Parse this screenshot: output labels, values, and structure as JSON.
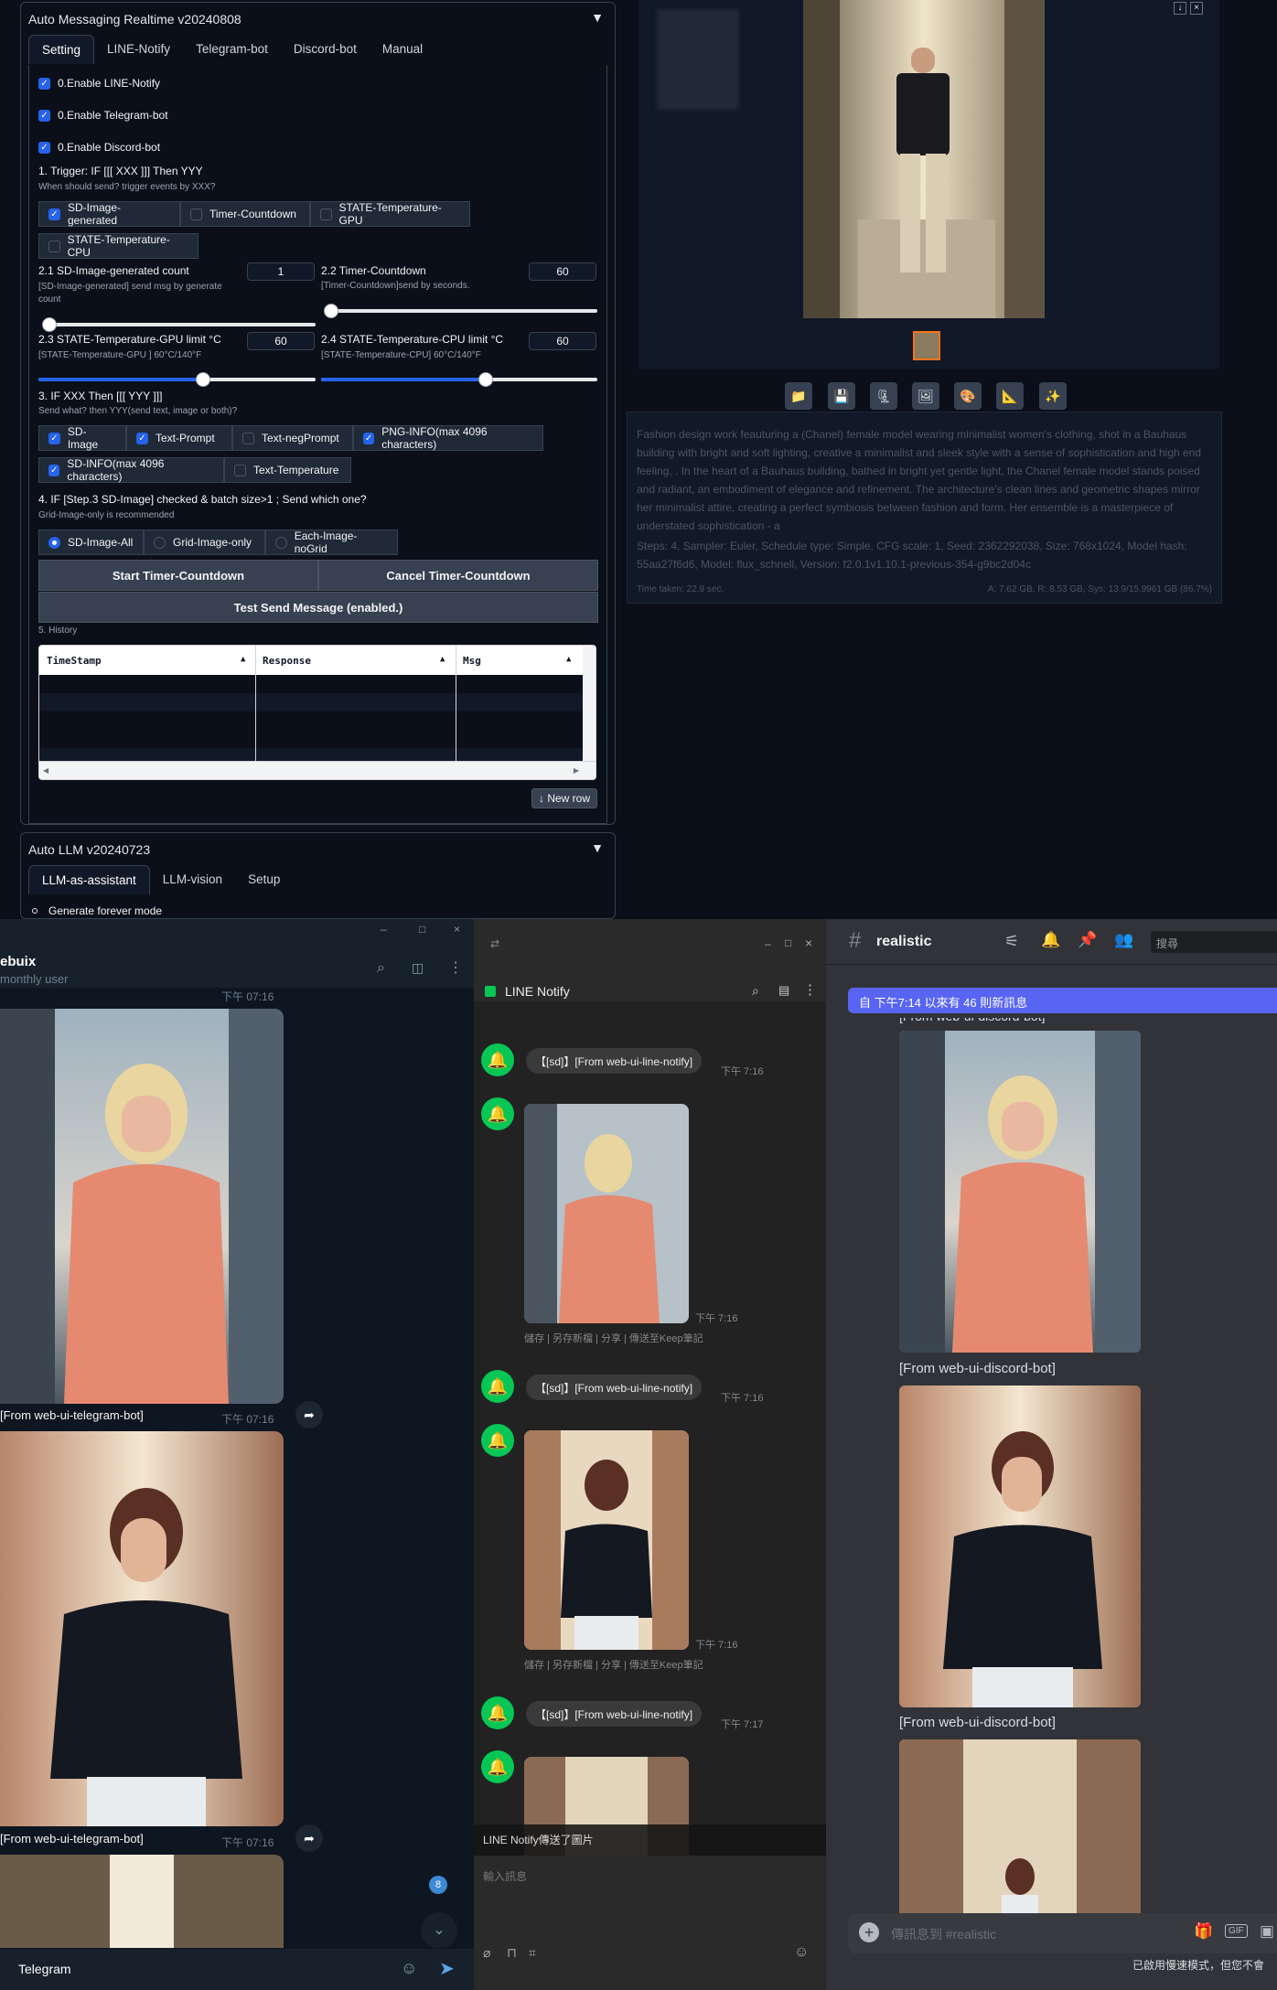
{
  "sd_ui": {
    "messaging": {
      "title": "Auto Messaging Realtime v20240808",
      "tabs": [
        "Setting",
        "LINE-Notify",
        "Telegram-bot",
        "Discord-bot",
        "Manual"
      ],
      "enable_line": "0.Enable LINE-Notify",
      "enable_telegram": "0.Enable Telegram-bot",
      "enable_discord": "0.Enable Discord-bot",
      "trigger_title": "1. Trigger: IF [[[ XXX ]]] Then YYY",
      "trigger_sub": "When should send? trigger events by XXX?",
      "trigger_opts": [
        "SD-Image-generated",
        "Timer-Countdown",
        "STATE-Temperature-GPU",
        "STATE-Temperature-CPU"
      ],
      "count_label": "2.1 SD-Image-generated count",
      "count_sub": "[SD-Image-generated] send msg by generate count",
      "count_value": "1",
      "timer_label": "2.2 Timer-Countdown",
      "timer_sub": "[Timer-Countdown]send by seconds.",
      "timer_value": "60",
      "gpu_label": "2.3 STATE-Temperature-GPU limit °C",
      "gpu_sub": "[STATE-Temperature-GPU ] 60°C/140°F",
      "gpu_value": "60",
      "cpu_label": "2.4 STATE-Temperature-CPU limit °C",
      "cpu_sub": "[STATE-Temperature-CPU] 60°C/140°F",
      "cpu_value": "60",
      "send_title": "3. IF XXX Then [[[ YYY ]]]",
      "send_sub": "Send what? then YYY(send text, image or both)?",
      "send_opts": [
        "SD-Image",
        "Text-Prompt",
        "Text-negPrompt",
        "PNG-INFO(max 4096 characters)",
        "SD-INFO(max 4096 characters)",
        "Text-Temperature"
      ],
      "batch_title": "4. IF [Step.3 SD-Image] checked & batch size>1 ; Send which one?",
      "batch_sub": "Grid-Image-only is recommended",
      "batch_opts": [
        "SD-Image-All",
        "Grid-Image-only",
        "Each-Image-noGrid"
      ],
      "start_btn": "Start Timer-Countdown",
      "cancel_btn": "Cancel Timer-Countdown",
      "test_btn": "Test Send Message (enabled.)",
      "history_title": "5. History",
      "history_cols": [
        "TimeStamp",
        "Response",
        "Msg"
      ],
      "new_row": "↓ New row"
    },
    "llm": {
      "title": "Auto LLM v20240723",
      "tabs": [
        "LLM-as-assistant",
        "LLM-vision",
        "Setup"
      ],
      "forever": "Generate forever mode"
    },
    "info": {
      "prompt": "Fashion design work feauturing a (Chanel) female model wearing minimalist women's clothing, shot in a Bauhaus building with bright and soft lighting, creative a minimalist and sleek style with a sense of sophistication and high end feeling, . In the heart of a Bauhaus building, bathed in bright yet gentle light, the Chanel female model stands poised and radiant, an embodiment of elegance and refinement. The architecture's clean lines and geometric shapes mirror her minimalist attire, creating a perfect symbiosis between fashion and form. Her ensemble is a masterpiece of understated sophistication - a",
      "params": "Steps: 4, Sampler: Euler, Schedule type: Simple, CFG scale: 1, Seed: 2362292038, Size: 768x1024, Model hash: 55aa27f6d6, Model: flux_schnell, Version: f2.0.1v1.10.1-previous-354-g9bc2d04c",
      "time": "Time taken: 22.9 sec.",
      "mem": "A: 7.62 GB, R: 8.53 GB, Sys: 13.9/15.9961 GB (86.7%)"
    }
  },
  "telegram": {
    "title": "ebuix",
    "subtitle": "monthly user",
    "caption": "[From web-ui-telegram-bot]",
    "time": "下午 07:16",
    "unread": "8",
    "input_placeholder": "Telegram"
  },
  "line": {
    "title": "LINE Notify",
    "message": "【[sd]】[From web-ui-line-notify]",
    "time1": "下午 7:16",
    "time2": "下午 7:17",
    "actions": "儲存 | 另存新檔 | 分享 | 傳送至Keep筆記",
    "toast": "LINE Notify傳送了圖片",
    "input_placeholder": "輸入訊息"
  },
  "discord": {
    "channel": "realistic",
    "search_placeholder": "搜尋",
    "new_banner": "自 下午7:14 以來有 46 則新訊息",
    "caption": "[From web-ui-discord-bot]",
    "input_placeholder": "傳訊息到 #realistic",
    "footer": "已啟用慢速模式，但您不會",
    "gif": "GIF"
  },
  "colors": {
    "accent": "#2563eb",
    "line_green": "#06c755",
    "discord_banner": "#5865f2"
  }
}
